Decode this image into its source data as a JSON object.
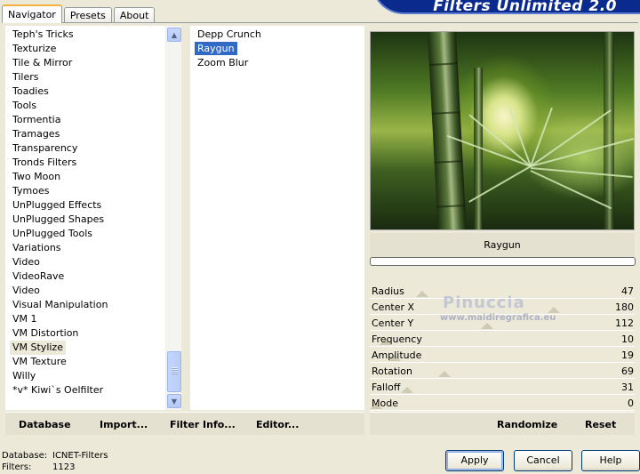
{
  "banner": {
    "title": "Filters Unlimited 2.0"
  },
  "tabs": [
    {
      "label": "Navigator",
      "active": true
    },
    {
      "label": "Presets",
      "active": false
    },
    {
      "label": "About",
      "active": false
    }
  ],
  "categories": {
    "items": [
      "Teph's Tricks",
      "Texturize",
      "Tile & Mirror",
      "Tilers",
      "Toadies",
      "Tools",
      "Tormentia",
      "Tramages",
      "Transparency",
      "Tronds Filters",
      "Two Moon",
      "Tymoes",
      "UnPlugged Effects",
      "UnPlugged Shapes",
      "UnPlugged Tools",
      "Variations",
      "Video",
      "VideoRave",
      "Video",
      "Visual Manipulation",
      "VM 1",
      "VM Distortion",
      "VM Stylize",
      "VM Texture",
      "Willy",
      "*v* Kiwi`s Oelfilter"
    ],
    "selected": "VM Stylize"
  },
  "filters": {
    "items": [
      "Depp Crunch",
      "Raygun",
      "Zoom Blur"
    ],
    "selected": "Raygun"
  },
  "preview": {
    "filter_name": "Raygun"
  },
  "parameters": [
    {
      "name": "Radius",
      "value": "47",
      "level": 47
    },
    {
      "name": "Center X",
      "value": "180",
      "level": 180
    },
    {
      "name": "Center Y",
      "value": "112",
      "level": 112
    },
    {
      "name": "Frequency",
      "value": "10",
      "level": 10
    },
    {
      "name": "Amplitude",
      "value": "19",
      "level": 19
    },
    {
      "name": "Rotation",
      "value": "69",
      "level": 69
    },
    {
      "name": "Falloff",
      "value": "31",
      "level": 31
    },
    {
      "name": "Mode",
      "value": "0",
      "level": 0
    }
  ],
  "watermark": {
    "line1": "Pinuccia",
    "line2": "www.maidiregrafica.eu"
  },
  "toolbar": {
    "database": "Database",
    "import": "Import...",
    "filter_info": "Filter Info...",
    "editor": "Editor...",
    "randomize": "Randomize",
    "reset": "Reset"
  },
  "status": {
    "database_label": "Database:",
    "database_value": "ICNET-Filters",
    "filters_label": "Filters:",
    "filters_value": "1123"
  },
  "buttons": {
    "apply": "Apply",
    "cancel": "Cancel",
    "help": "Help"
  }
}
